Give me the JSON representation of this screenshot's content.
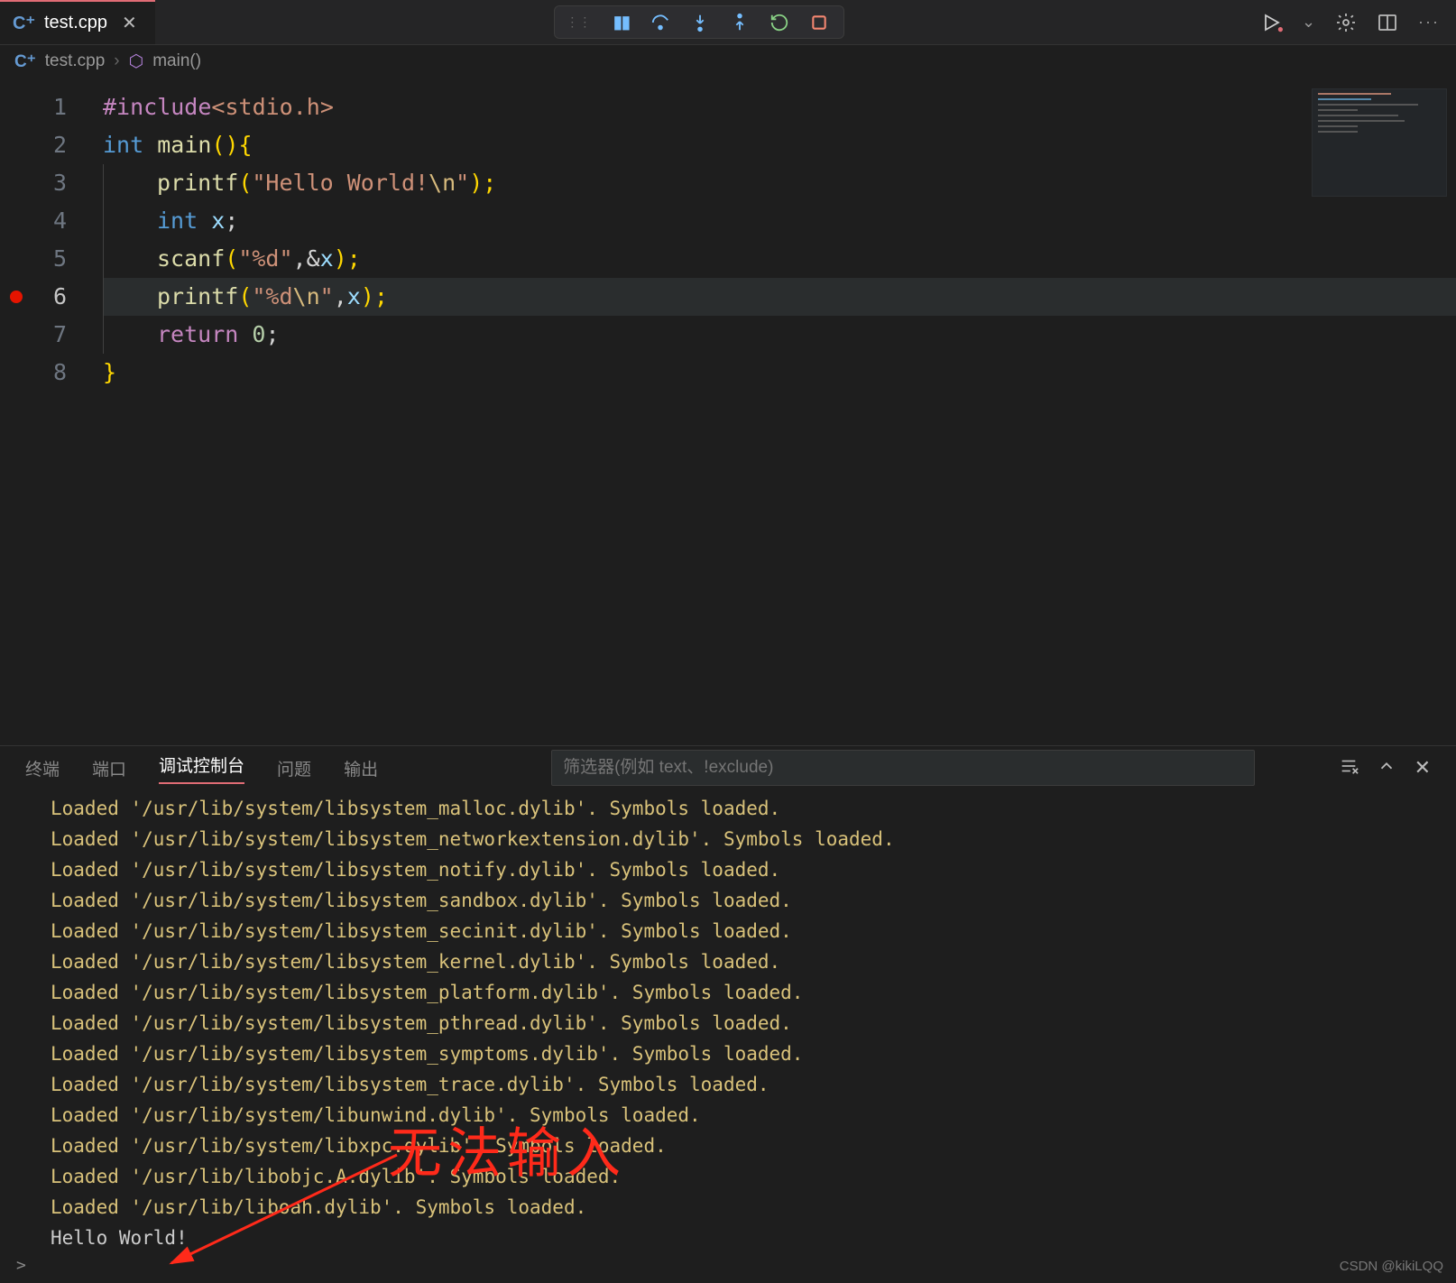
{
  "tab": {
    "filename": "test.cpp"
  },
  "breadcrumb": {
    "file": "test.cpp",
    "symbol": "main()"
  },
  "code": {
    "lines": [
      "1",
      "2",
      "3",
      "4",
      "5",
      "6",
      "7",
      "8"
    ],
    "breakpoint_line": 6,
    "highlight_line": 6,
    "l1": {
      "a": "#include",
      "b": "<stdio.h>"
    },
    "l2": {
      "a": "int",
      "b": "main",
      "c": "(){"
    },
    "l3": {
      "fn": "printf",
      "p1": "(",
      "s1": "\"Hello World!",
      "esc": "\\n",
      "s2": "\"",
      "p2": ");"
    },
    "l4": {
      "a": "int",
      "b": "x",
      "c": ";"
    },
    "l5": {
      "fn": "scanf",
      "p1": "(",
      "s": "\"%d\"",
      "mid": ",&",
      "v": "x",
      "p2": ");"
    },
    "l6": {
      "fn": "printf",
      "p1": "(",
      "s1": "\"%d",
      "esc": "\\n",
      "s2": "\"",
      "mid": ",",
      "v": "x",
      "p2": ");"
    },
    "l7": {
      "a": "return",
      "b": "0",
      "c": ";"
    },
    "l8": {
      "a": "}"
    }
  },
  "panel": {
    "tabs": {
      "terminal": "终端",
      "ports": "端口",
      "debug": "调试控制台",
      "problems": "问题",
      "output": "输出"
    },
    "filter_placeholder": "筛选器(例如 text、!exclude)",
    "console": [
      "Loaded '/usr/lib/system/libsystem_malloc.dylib'. Symbols loaded.",
      "Loaded '/usr/lib/system/libsystem_networkextension.dylib'. Symbols loaded.",
      "Loaded '/usr/lib/system/libsystem_notify.dylib'. Symbols loaded.",
      "Loaded '/usr/lib/system/libsystem_sandbox.dylib'. Symbols loaded.",
      "Loaded '/usr/lib/system/libsystem_secinit.dylib'. Symbols loaded.",
      "Loaded '/usr/lib/system/libsystem_kernel.dylib'. Symbols loaded.",
      "Loaded '/usr/lib/system/libsystem_platform.dylib'. Symbols loaded.",
      "Loaded '/usr/lib/system/libsystem_pthread.dylib'. Symbols loaded.",
      "Loaded '/usr/lib/system/libsystem_symptoms.dylib'. Symbols loaded.",
      "Loaded '/usr/lib/system/libsystem_trace.dylib'. Symbols loaded.",
      "Loaded '/usr/lib/system/libunwind.dylib'. Symbols loaded.",
      "Loaded '/usr/lib/system/libxpc.dylib'. Symbols loaded.",
      "Loaded '/usr/lib/libobjc.A.dylib'. Symbols loaded.",
      "Loaded '/usr/lib/liboah.dylib'. Symbols loaded.",
      "Hello World!"
    ],
    "prompt": ">"
  },
  "annotation": {
    "text": "无法输入"
  },
  "watermark": "CSDN @kikiLQQ"
}
